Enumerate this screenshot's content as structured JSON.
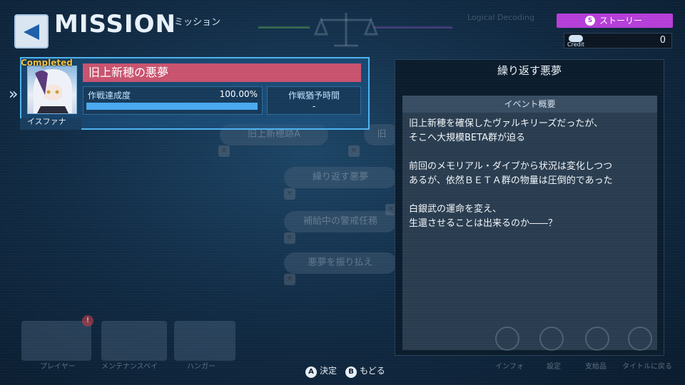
{
  "header": {
    "title": "MISSION",
    "subtitle": "ミッション",
    "faint_top_label": "Logical Decoding"
  },
  "status": {
    "story_badge_icon": "S",
    "story_badge": "ストーリー",
    "credit_label": "Credit",
    "credit_value": "0"
  },
  "mission": {
    "status": "Completed",
    "character_name": "イスファナ",
    "title": "旧上新穂の悪夢",
    "achievement_label": "作戦達成度",
    "achievement_value": "100.00%",
    "achievement_progress": 1.0,
    "time_label": "作戦猶予時間",
    "time_value": "-"
  },
  "detail": {
    "title": "繰り返す悪夢",
    "section_header": "イベント概要",
    "paragraphs": [
      "旧上新穂を確保したヴァルキリーズだったが、\nそこへ大規模BETA群が迫る",
      "前回のメモリアル・ダイブから状況は変化しつつ\nあるが、依然ＢＥＴＡ群の物量は圧倒的であった",
      "白銀武の運命を変え、\n生還させることは出来るのか――？"
    ]
  },
  "background_nodes": [
    "旧上新穂跡A",
    "繰り返す悪夢",
    "補給中の警戒任務",
    "悪夢を振り払え"
  ],
  "bottom_menu": {
    "badge": "!",
    "items_left": [
      "プレイヤー",
      "メンテナンスベイ",
      "ハンガー"
    ],
    "items_right": [
      "インフォ",
      "設定",
      "支給品",
      "タイトルに戻る"
    ]
  },
  "hints": {
    "a_key": "A",
    "a_label": "決定",
    "b_key": "B",
    "b_label": "もどる"
  },
  "colors": {
    "accent_blue": "#4eb3f0",
    "story_purple": "#b63ed8",
    "title_pink": "#c8536f",
    "completed_gold": "#f2c040"
  }
}
